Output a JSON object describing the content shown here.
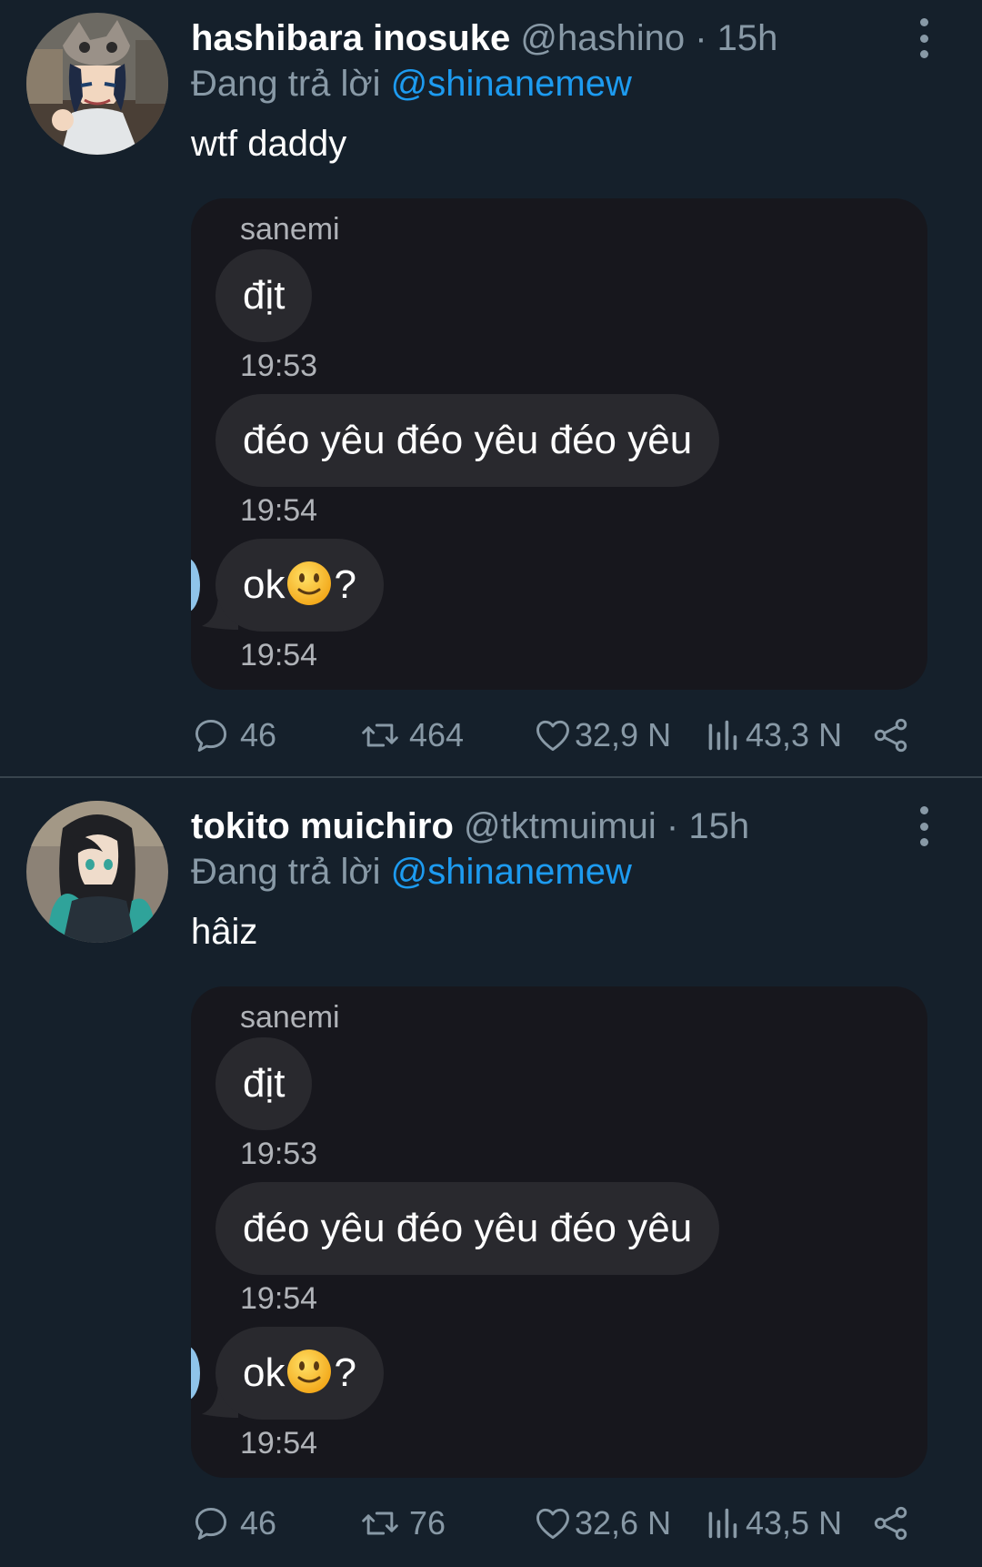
{
  "tweets": [
    {
      "display_name": "hashibara inosuke",
      "handle": "@hashino",
      "separator": "·",
      "time": "15h",
      "replying_prefix": "Đang trả lời",
      "replying_to": "@shinanemew",
      "text": "wtf daddy",
      "media": {
        "sender": "sanemi",
        "messages": [
          {
            "text": "địt",
            "time": "19:53"
          },
          {
            "text": "đéo yêu đéo yêu đéo yêu",
            "time": "19:54"
          },
          {
            "text_before": "ok",
            "emoji": "slightly-smiling-face",
            "text_after": "?",
            "time": "19:54"
          }
        ]
      },
      "stats": {
        "replies": "46",
        "retweets": "464",
        "likes": "32,9 N",
        "views": "43,3 N"
      }
    },
    {
      "display_name": "tokito muichiro",
      "handle": "@tktmuimui",
      "separator": "·",
      "time": "15h",
      "replying_prefix": "Đang trả lời",
      "replying_to": "@shinanemew",
      "text": "hâiz",
      "media": {
        "sender": "sanemi",
        "messages": [
          {
            "text": "địt",
            "time": "19:53"
          },
          {
            "text": "đéo yêu đéo yêu đéo yêu",
            "time": "19:54"
          },
          {
            "text_before": "ok",
            "emoji": "slightly-smiling-face",
            "text_after": "?",
            "time": "19:54"
          }
        ]
      },
      "stats": {
        "replies": "46",
        "retweets": "76",
        "likes": "32,6 N",
        "views": "43,5 N"
      }
    }
  ],
  "icons": {
    "reply": "comment-bubble-icon",
    "retweet": "retweet-icon",
    "like": "heart-icon",
    "views": "views-bar-chart-icon",
    "share": "share-icon",
    "more": "vertical-dots-icon"
  },
  "colors": {
    "background": "#15202b",
    "link": "#1d9bf0",
    "secondary_text": "#8899a6",
    "media_background": "#17171d",
    "bubble": "#29292e"
  }
}
